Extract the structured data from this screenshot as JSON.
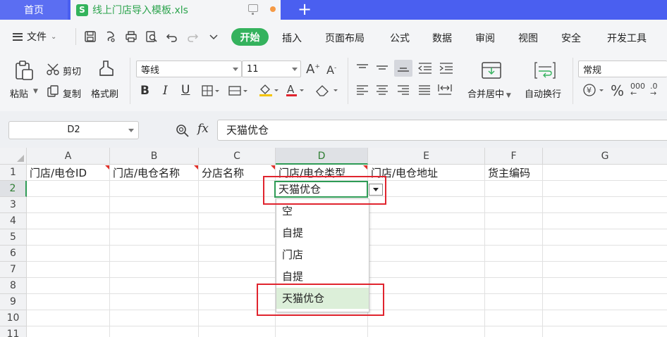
{
  "tabs": {
    "home": "首页",
    "file_icon_letter": "S",
    "file_title": "线上门店导入模板.xls",
    "new_tab": "+"
  },
  "menu": {
    "file_label": "文件",
    "start": "开始",
    "items": [
      "插入",
      "页面布局",
      "公式",
      "数据",
      "审阅",
      "视图",
      "安全",
      "开发工具"
    ]
  },
  "ribbon": {
    "paste": "粘贴",
    "cut": "剪切",
    "copy": "复制",
    "format_painter": "格式刷",
    "font_name": "等线",
    "font_size": "11",
    "merge_center": "合并居中",
    "wrap_text": "自动换行",
    "number_format": "常规"
  },
  "formula_bar": {
    "name_box": "D2",
    "fx": "fx",
    "value": "天猫优仓"
  },
  "grid": {
    "columns": [
      "A",
      "B",
      "C",
      "D",
      "E",
      "F",
      "G"
    ],
    "rows": [
      "1",
      "2",
      "3",
      "4",
      "5",
      "6",
      "7",
      "8",
      "9",
      "10",
      "11"
    ],
    "header_row": [
      "门店/电仓ID",
      "门店/电仓名称",
      "分店名称",
      "门店/电仓类型",
      "门店/电仓地址",
      "货主编码"
    ],
    "active_value": "天猫优仓"
  },
  "dropdown": {
    "options": [
      "空",
      "自提",
      "门店",
      "自提",
      "天猫优仓"
    ],
    "selected_index": 4
  },
  "colors": {
    "tab_bar": "#4a5ff0",
    "accent_green": "#34b25d",
    "highlight_red": "#e0242e"
  }
}
